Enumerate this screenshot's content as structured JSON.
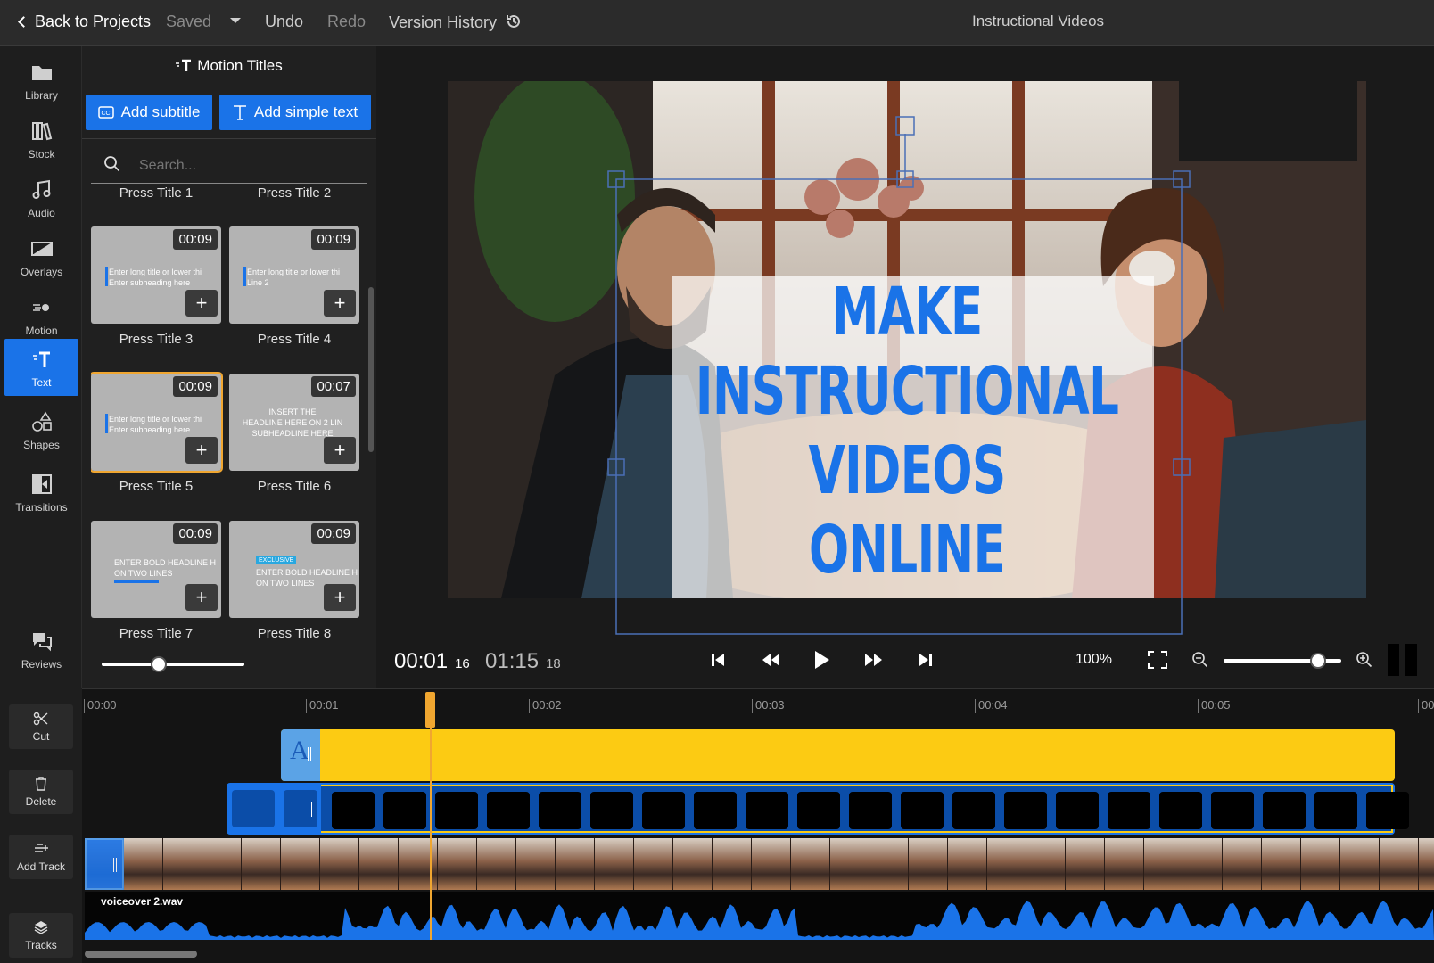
{
  "topbar": {
    "back": "Back to Projects",
    "saved": "Saved",
    "undo": "Undo",
    "redo": "Redo",
    "version_history": "Version History",
    "project_title": "Instructional Videos"
  },
  "leftnav": {
    "items": [
      {
        "label": "Library",
        "icon": "folder-icon"
      },
      {
        "label": "Stock",
        "icon": "stock-icon"
      },
      {
        "label": "Audio",
        "icon": "music-note-icon"
      },
      {
        "label": "Overlays",
        "icon": "overlay-icon"
      },
      {
        "label": "Motion",
        "icon": "motion-icon"
      },
      {
        "label": "Text",
        "icon": "text-icon",
        "active": true
      },
      {
        "label": "Shapes",
        "icon": "shapes-icon"
      },
      {
        "label": "Transitions",
        "icon": "transitions-icon"
      }
    ],
    "reviews": "Reviews"
  },
  "panel": {
    "title": "Motion Titles",
    "add_subtitle": "Add subtitle",
    "add_simple_text": "Add simple text",
    "search_placeholder": "Search...",
    "partial_captions": [
      "Press Title 1",
      "Press Title 2"
    ],
    "templates": [
      {
        "name": "Press Title 3",
        "duration": "00:09",
        "preview_line1": "Enter long title or lower thi",
        "preview_line2": "Enter subheading here"
      },
      {
        "name": "Press Title 4",
        "duration": "00:09",
        "preview_line1": "Enter long title or lower thi",
        "preview_line2": "Line 2"
      },
      {
        "name": "Press Title 5",
        "duration": "00:09",
        "preview_line1": "Enter long title or lower thi",
        "preview_line2": "Enter subheading here",
        "selected": true
      },
      {
        "name": "Press Title 6",
        "duration": "00:07",
        "preview_line1": "INSERT THE",
        "preview_line2": "HEADLINE HERE ON 2 LIN",
        "preview_line3": "SUBHEADLINE HERE"
      },
      {
        "name": "Press Title 7",
        "duration": "00:09",
        "preview_line1": "ENTER BOLD HEADLINE H",
        "preview_line2": "ON TWO LINES"
      },
      {
        "name": "Press Title 8",
        "duration": "00:09",
        "preview_tag": "EXCLUSIVE",
        "preview_line1": "ENTER BOLD HEADLINE H",
        "preview_line2": "ON TWO LINES"
      }
    ],
    "size_slider_fraction": 0.4
  },
  "preview": {
    "overlay_text": [
      "MAKE",
      "INSTRUCTIONAL",
      "VIDEOS",
      "ONLINE"
    ],
    "overlay_color": "#1a73e8"
  },
  "player": {
    "current_time": "00:01",
    "current_frame": "16",
    "total_time": "01:15",
    "total_frame": "18",
    "zoom": "100%",
    "zoom_slider_fraction": 0.8
  },
  "timeline": {
    "ticks": [
      "00:00",
      "00:01",
      "00:02",
      "00:03",
      "00:04",
      "00:05",
      "00"
    ],
    "playhead_time": "00:01.5",
    "audio_label": "voiceover 2.wav",
    "tools": [
      "Cut",
      "Delete",
      "Add Track",
      "Tracks"
    ],
    "colors": {
      "text_clip": "#fccb13",
      "blue_clip": "#1a73e8",
      "playhead": "#f0a630"
    }
  }
}
